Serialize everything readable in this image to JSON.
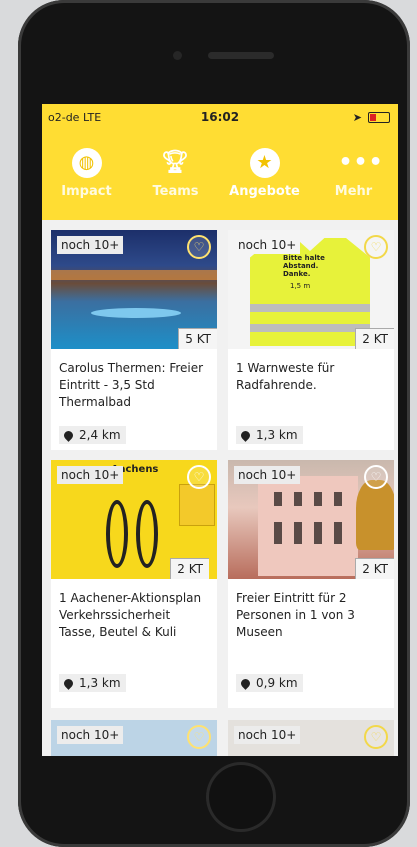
{
  "status": {
    "carrier": "o2-de LTE",
    "time": "16:02"
  },
  "nav": [
    {
      "label": "Impact",
      "icon": "globe-icon"
    },
    {
      "label": "Teams",
      "icon": "trophy-icon"
    },
    {
      "label": "Angebote",
      "icon": "star-icon",
      "active": true
    },
    {
      "label": "Mehr",
      "icon": "more-dots-icon"
    }
  ],
  "cards": [
    {
      "badge": "noch 10+",
      "price": "5 KT",
      "title": "Carolus Thermen: Freier Eintritt - 3,5 Std Thermalbad",
      "distance": "2,4 km"
    },
    {
      "badge": "noch 10+",
      "price": "2 KT",
      "title": "1 Warnweste für Radfahrende.",
      "distance": "1,3 km"
    },
    {
      "badge": "noch 10+",
      "price": "2 KT",
      "title": "1 Aachener-Aktionsplan Verkehrssicherheit Tasse, Beutel & Kuli",
      "distance": "1,3 km"
    },
    {
      "badge": "noch 10+",
      "price": "2 KT",
      "title": "Freier Eintritt für 2 Personen in 1 von 3 Museen",
      "distance": "0,9 km"
    },
    {
      "badge": "noch 10+"
    },
    {
      "badge": "noch 10+"
    }
  ],
  "vest_text": "Bitte halte Abstand. Danke.",
  "vest_distance": "1,5 m",
  "mug_text": "Aachens"
}
